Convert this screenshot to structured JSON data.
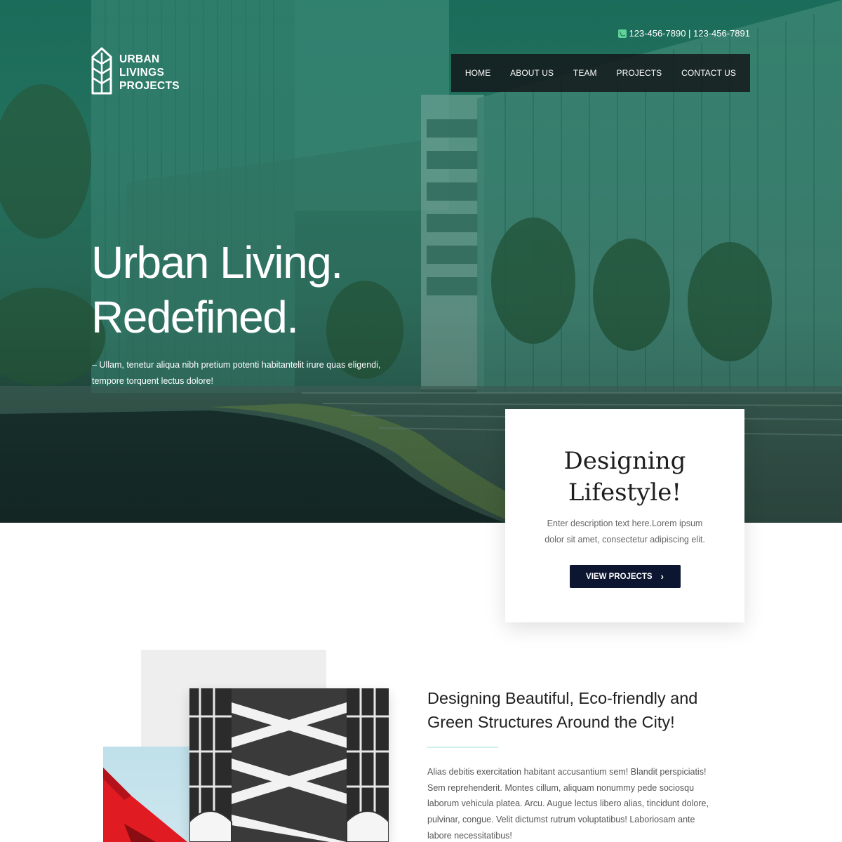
{
  "brand": {
    "logo_lines": [
      "URBAN",
      "LIVINGS",
      "PROJECTS"
    ]
  },
  "header": {
    "phone": "123-456-7890 | 123-456-7891"
  },
  "nav": {
    "items": [
      {
        "label": "HOME"
      },
      {
        "label": "ABOUT US"
      },
      {
        "label": "TEAM"
      },
      {
        "label": "PROJECTS"
      },
      {
        "label": "CONTACT US"
      }
    ]
  },
  "hero": {
    "headline_line1": "Urban Living.",
    "headline_line2": "Redefined.",
    "subtext": "– Ullam, tenetur aliqua nibh pretium potenti habitantelit irure quas eligendi, tempore torquent lectus dolore!"
  },
  "card": {
    "title_line1": "Designing",
    "title_line2": "Lifestyle!",
    "description": "Enter description text here.Lorem ipsum dolor sit amet, consectetur adipiscing elit.",
    "button_label": "VIEW PROJECTS"
  },
  "section": {
    "title_line1": "Designing Beautiful, Eco-friendly and",
    "title_line2": "Green Structures Around the City!",
    "body": "Alias debitis exercitation habitant accusantium sem! Blandit perspiciatis! Sem reprehenderit. Montes cillum, aliquam nonummy pede sociosqu laborum vehicula platea. Arcu. Augue lectus libero alias, tincidunt dolore, pulvinar, congue. Velit dictumst rutrum voluptatibus! Laboriosam ante labore necessitatibus!"
  },
  "colors": {
    "hero_tint": "#1f6b5a",
    "nav_bg": "#14181a",
    "button_bg": "#0c1630",
    "accent_rule": "#cfeff0",
    "phone_icon": "#5fd39a"
  },
  "icons": {
    "phone": "phone-icon",
    "button_chevron": "chevron-right-icon",
    "logo": "leaf-logo-icon"
  }
}
